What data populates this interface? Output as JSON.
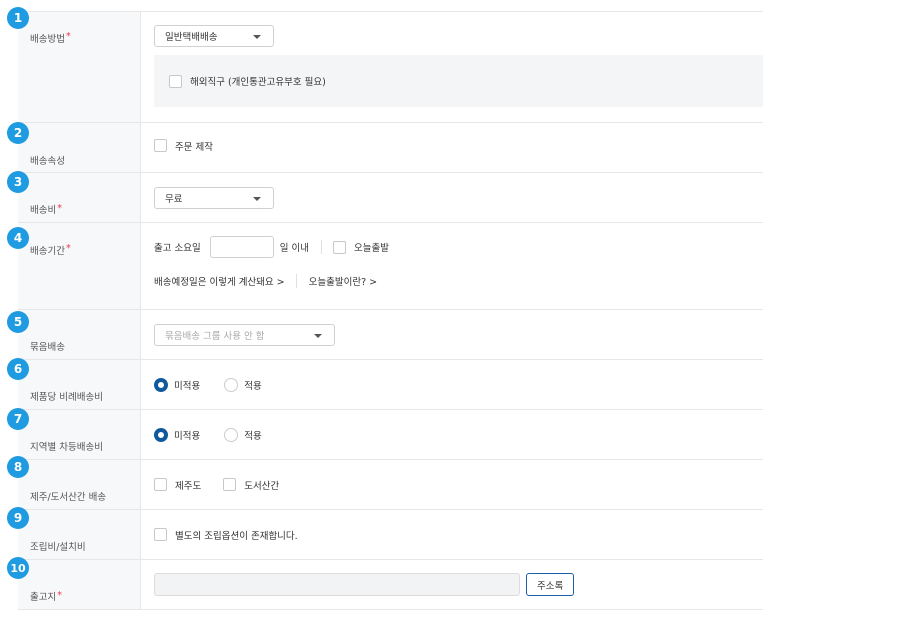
{
  "badges": [
    "1",
    "2",
    "3",
    "4",
    "5",
    "6",
    "7",
    "8",
    "9",
    "10"
  ],
  "rows": {
    "shipping_method": {
      "label": "배송방법",
      "required": "*",
      "select_value": "일반택배배송",
      "overseas_label": "해외직구 (개인통관고유부호 필요)"
    },
    "shipping_attr": {
      "label": "배송속성",
      "custom_label": "주문 제작"
    },
    "shipping_fee": {
      "label": "배송비",
      "required": "*",
      "select_value": "무료"
    },
    "shipping_period": {
      "label": "배송기간",
      "required": "*",
      "lead_prefix": "출고 소요일",
      "lead_suffix": "일 이내",
      "today_label": "오늘출발",
      "link_calc": "배송예정일은 이렇게 계산돼요 >",
      "link_today": "오늘출발이란? >"
    },
    "bundle": {
      "label": "묶음배송",
      "select_value": "묶음배송 그룹 사용 안 함"
    },
    "proportional": {
      "label": "제품당 비례배송비",
      "opt_off": "미적용",
      "opt_on": "적용"
    },
    "regional": {
      "label": "지역별 차등배송비",
      "opt_off": "미적용",
      "opt_on": "적용"
    },
    "island": {
      "label": "제주/도서산간 배송",
      "opt_jeju": "제주도",
      "opt_island": "도서산간"
    },
    "install": {
      "label": "조립비/설치비",
      "opt_label": "별도의 조립옵션이 존재합니다."
    },
    "origin": {
      "label": "출고지",
      "required": "*",
      "button_label": "주소록"
    }
  },
  "colors": {
    "badge": "#1e9be1",
    "required": "#e8394d",
    "radio_selected": "#0f5a9c"
  }
}
